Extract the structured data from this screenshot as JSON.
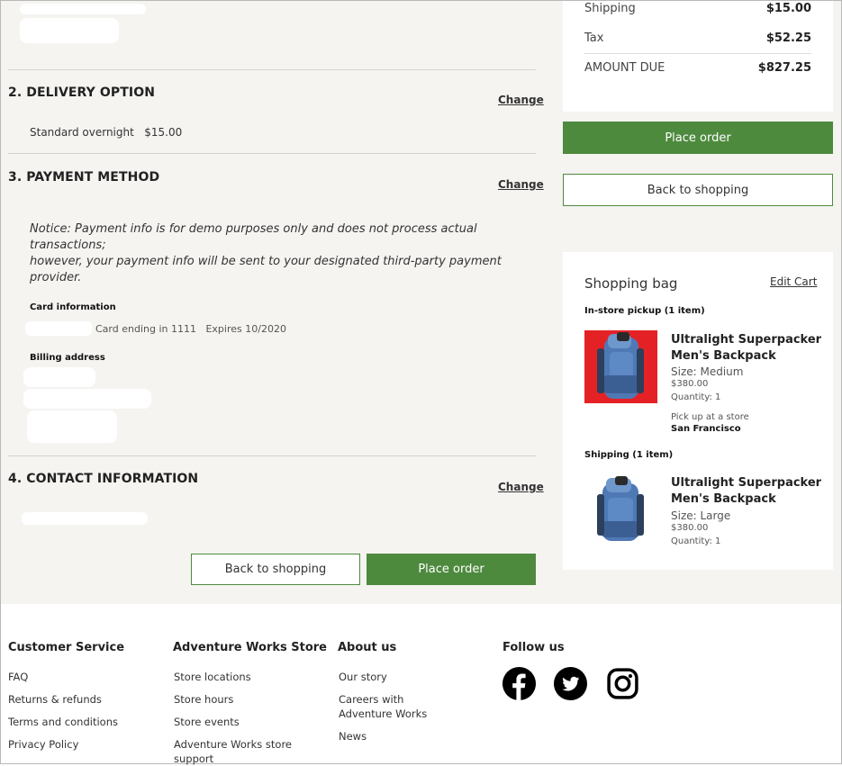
{
  "sections": {
    "delivery": {
      "title": "2. DELIVERY OPTION",
      "change": "Change",
      "option": "Standard overnight",
      "price": "$15.00"
    },
    "payment": {
      "title": "3. PAYMENT METHOD",
      "change": "Change",
      "notice_line1": "Notice: Payment info is for demo purposes only and does not process actual transactions;",
      "notice_line2": "however, your payment info will be sent to your designated third-party payment provider.",
      "card_info_label": "Card information",
      "card_detail": "Card ending in 1111   Expires 10/2020",
      "billing_label": "Billing address"
    },
    "contact": {
      "title": "4. CONTACT INFORMATION",
      "change": "Change"
    }
  },
  "bottom_buttons": {
    "back": "Back to shopping",
    "place": "Place order"
  },
  "summary": {
    "shipping_label": "Shipping",
    "shipping_value": "$15.00",
    "tax_label": "Tax",
    "tax_value": "$52.25",
    "due_label": "AMOUNT DUE",
    "due_value": "$827.25",
    "place_order": "Place order",
    "back_to_shopping": "Back to shopping"
  },
  "bag": {
    "title": "Shopping bag",
    "edit_cart": "Edit Cart",
    "pickup_header": "In-store pickup (1 item)",
    "shipping_header": "Shipping (1 item)",
    "items": [
      {
        "name_line1": "Ultralight Superpacker",
        "name_line2": "Men's Backpack",
        "size": "Size: Medium",
        "price": "$380.00",
        "quantity": "Quantity: 1",
        "pickup_note": "Pick up at a store",
        "store": "San Francisco",
        "image_bg": "#e42226"
      },
      {
        "name_line1": "Ultralight Superpacker",
        "name_line2": "Men's Backpack",
        "size": "Size: Large",
        "price": "$380.00",
        "quantity": "Quantity: 1",
        "image_bg": "#ffffff"
      }
    ]
  },
  "footer": {
    "columns": [
      {
        "heading": "Customer Service",
        "links": [
          "FAQ",
          "Returns & refunds",
          "Terms and conditions",
          "Privacy Policy"
        ]
      },
      {
        "heading": "Adventure Works Store",
        "links": [
          "Store locations",
          "Store hours",
          "Store events",
          "Adventure Works store support"
        ]
      },
      {
        "heading": "About us",
        "links": [
          "Our story",
          "Careers with Adventure Works",
          "News"
        ]
      },
      {
        "heading": "Follow us",
        "icons": [
          "facebook-icon",
          "twitter-icon",
          "instagram-icon"
        ]
      }
    ]
  },
  "colors": {
    "accent_green": "#4e8a3e",
    "page_bg": "#f5f4f1"
  }
}
